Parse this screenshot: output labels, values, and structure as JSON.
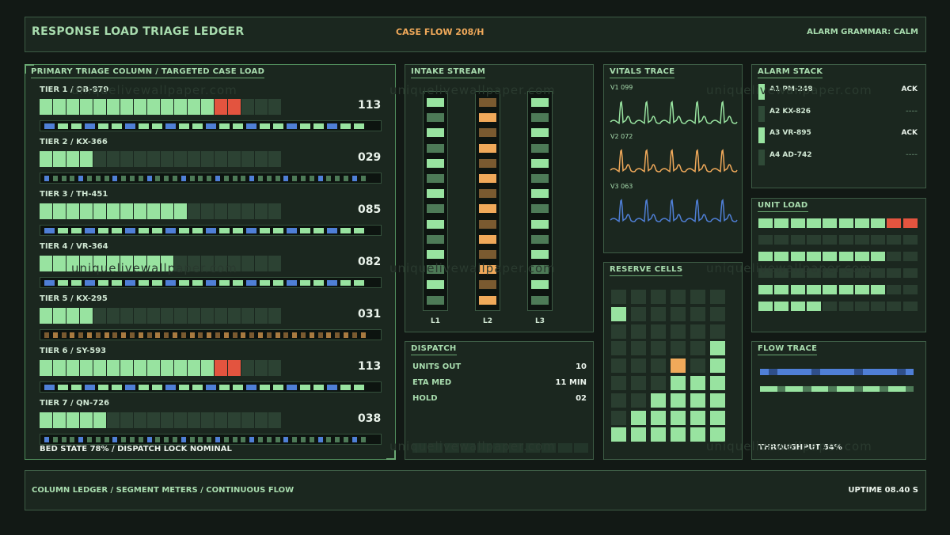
{
  "header": {
    "title": "RESPONSE LOAD TRIAGE LEDGER",
    "case_flow": "CASE FLOW 208/H",
    "alarm_grammar": "ALARM GRAMMAR: CALM"
  },
  "colors": {
    "bg": "#121915",
    "panel": "#1b271f",
    "green": "#98e3a0",
    "green_dim": "#2c4233",
    "green_mid": "#4d7a57",
    "red": "#e3543f",
    "orange": "#f0a95a",
    "orange_dim": "#7a5a30",
    "blue": "#4f7fd6"
  },
  "primary": {
    "title": "PRIMARY TRIAGE COLUMN / TARGETED CASE LOAD",
    "tiers": [
      {
        "label": "TIER 1 / OB-879",
        "value": "113",
        "filled": 13,
        "red": 2,
        "track_style": "blue"
      },
      {
        "label": "TIER 2 / KX-366",
        "value": "029",
        "filled": 4,
        "red": 0,
        "track_style": "blue-sparse"
      },
      {
        "label": "TIER 3 / TH-451",
        "value": "085",
        "filled": 11,
        "red": 0,
        "track_style": "blue"
      },
      {
        "label": "TIER 4 / VR-364",
        "value": "082",
        "filled": 10,
        "red": 0,
        "track_style": "blue"
      },
      {
        "label": "TIER 5 / KX-295",
        "value": "031",
        "filled": 4,
        "red": 0,
        "track_style": "orange"
      },
      {
        "label": "TIER 6 / SY-593",
        "value": "113",
        "filled": 13,
        "red": 2,
        "track_style": "blue"
      },
      {
        "label": "TIER 7 / QN-726",
        "value": "038",
        "filled": 5,
        "red": 0,
        "track_style": "blue-sparse"
      }
    ],
    "bed_state": "BED STATE 78%  /  DISPATCH LOCK NOMINAL"
  },
  "intake": {
    "title": "INTAKE STREAM",
    "lanes": [
      {
        "label": "L1",
        "color": "green"
      },
      {
        "label": "L2",
        "color": "orange"
      },
      {
        "label": "L3",
        "color": "green"
      }
    ]
  },
  "dispatch": {
    "title": "DISPATCH",
    "rows": [
      {
        "key": "UNITS OUT",
        "value": "10"
      },
      {
        "key": "ETA MED",
        "value": "11 MIN"
      },
      {
        "key": "HOLD",
        "value": "02"
      }
    ]
  },
  "vitals": {
    "title": "VITALS TRACE",
    "traces": [
      {
        "label": "V1 099",
        "color": "#98e3a0"
      },
      {
        "label": "V2 072",
        "color": "#f0a95a"
      },
      {
        "label": "V3 063",
        "color": "#4f7fd6"
      }
    ]
  },
  "reserve": {
    "title": "RESERVE CELLS",
    "column_fill": [
      1,
      2,
      3,
      5,
      4,
      6
    ],
    "orange_cell": {
      "col": 3,
      "row_from_bottom": 4
    }
  },
  "alarm": {
    "title": "ALARM STACK",
    "rows": [
      {
        "label": "A1 PM-248",
        "status": "ACK",
        "active": true
      },
      {
        "label": "A2 KX-826",
        "status": "----",
        "active": false
      },
      {
        "label": "A3 VR-895",
        "status": "ACK",
        "active": true
      },
      {
        "label": "A4 AD-742",
        "status": "----",
        "active": false
      }
    ]
  },
  "unit_load": {
    "title": "UNIT LOAD",
    "rows": [
      {
        "filled": 8,
        "red": 2
      },
      {
        "filled": 0,
        "red": 0
      },
      {
        "filled": 8,
        "red": 0
      },
      {
        "filled": 0,
        "red": 0
      },
      {
        "filled": 8,
        "red": 0
      },
      {
        "filled": 4,
        "red": 0
      }
    ]
  },
  "flow_trace": {
    "title": "FLOW TRACE",
    "throughput": "THROUGHPUT 54%"
  },
  "footer": {
    "left": "COLUMN LEDGER / SEGMENT METERS / CONTINUOUS FLOW",
    "right": "UPTIME 08.40 S"
  },
  "watermark": "uniquelivewallpaper.com"
}
